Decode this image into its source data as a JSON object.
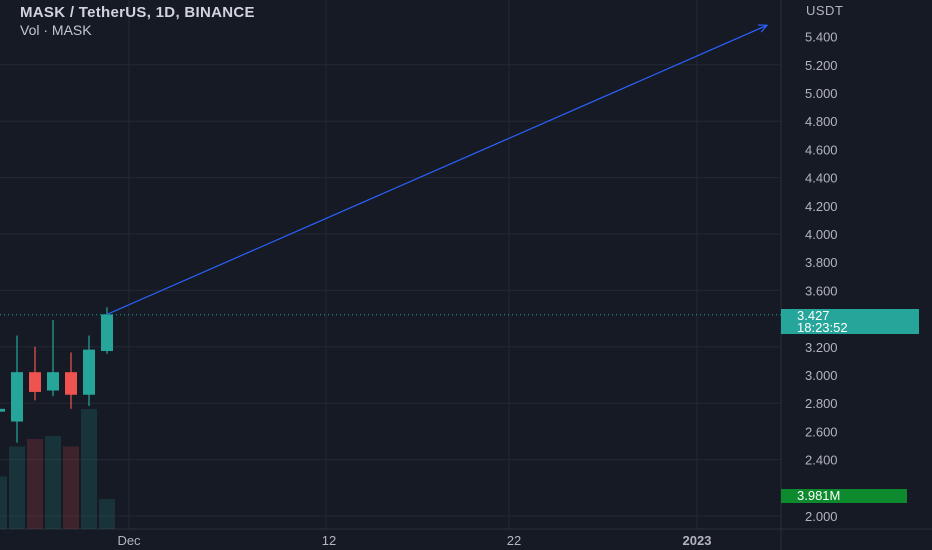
{
  "legend": {
    "symbol_title": "MASK / TetherUS, 1D, BINANCE",
    "volume_title": "Vol · MASK"
  },
  "price_axis": {
    "currency": "USDT",
    "ticks": [
      "5.400",
      "5.200",
      "5.000",
      "4.800",
      "4.600",
      "4.400",
      "4.200",
      "4.000",
      "3.800",
      "3.600",
      "3.200",
      "3.000",
      "2.800",
      "2.600",
      "2.400",
      "2.000"
    ]
  },
  "time_axis": {
    "ticks": [
      "Dec",
      "12",
      "22",
      "2023"
    ]
  },
  "last_price": {
    "value": "3.427",
    "countdown": "18:23:52",
    "color": "#26a69a"
  },
  "volume_badge": {
    "value": "3.981M",
    "color": "#0d8a2d"
  },
  "colors": {
    "background": "#161a25",
    "up": "#26a69a",
    "down": "#ef5350",
    "arrow": "#2962ff",
    "grid": "#232834"
  },
  "chart_data": {
    "type": "candlestick",
    "ylim": [
      1.9,
      5.6
    ],
    "candles": [
      {
        "open": 2.74,
        "high": 2.78,
        "low": 2.72,
        "close": 2.76
      },
      {
        "open": 2.67,
        "high": 3.28,
        "low": 2.52,
        "close": 3.02
      },
      {
        "open": 3.02,
        "high": 3.2,
        "low": 2.82,
        "close": 2.88
      },
      {
        "open": 2.89,
        "high": 3.39,
        "low": 2.85,
        "close": 3.02
      },
      {
        "open": 3.02,
        "high": 3.16,
        "low": 2.76,
        "close": 2.86
      },
      {
        "open": 2.86,
        "high": 3.28,
        "low": 2.78,
        "close": 3.18
      },
      {
        "open": 3.17,
        "high": 3.48,
        "low": 3.15,
        "close": 3.43
      }
    ],
    "volume": [
      0.35,
      0.55,
      0.6,
      0.62,
      0.55,
      0.8,
      0.2
    ],
    "arrow": {
      "from_price": 3.43,
      "to_price": 5.48
    }
  }
}
